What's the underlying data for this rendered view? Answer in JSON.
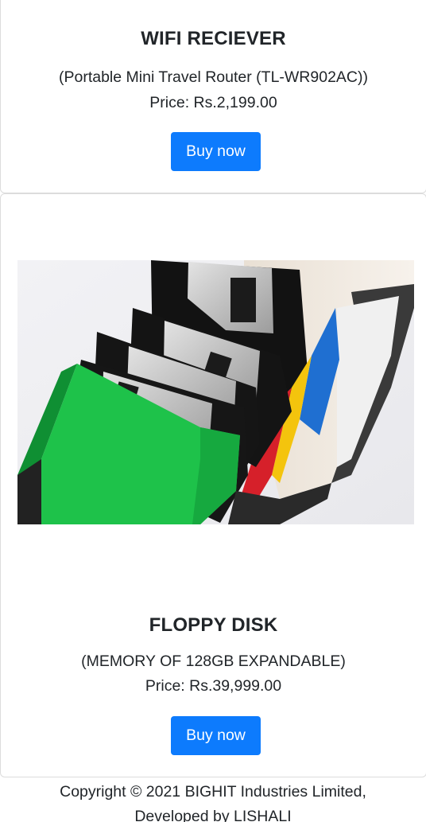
{
  "products": [
    {
      "title": "WIFI RECIEVER",
      "description": "(Portable Mini Travel Router (TL-WR902AC))",
      "price": "Price: Rs.2,199.00",
      "button_label": "Buy now"
    },
    {
      "title": "FLOPPY DISK",
      "description": "(MEMORY OF 128GB EXPANDABLE)",
      "price": "Price: Rs.39,999.00",
      "button_label": "Buy now",
      "image_icon": "floppy-disks-in-box-photo"
    }
  ],
  "footer": {
    "line1": "Copyright © 2021 BIGHIT Industries Limited,",
    "line2": "Developed by LISHALI"
  },
  "colors": {
    "button": "#0d7bfd",
    "text": "#212529",
    "card_border": "#dcdcdc"
  }
}
